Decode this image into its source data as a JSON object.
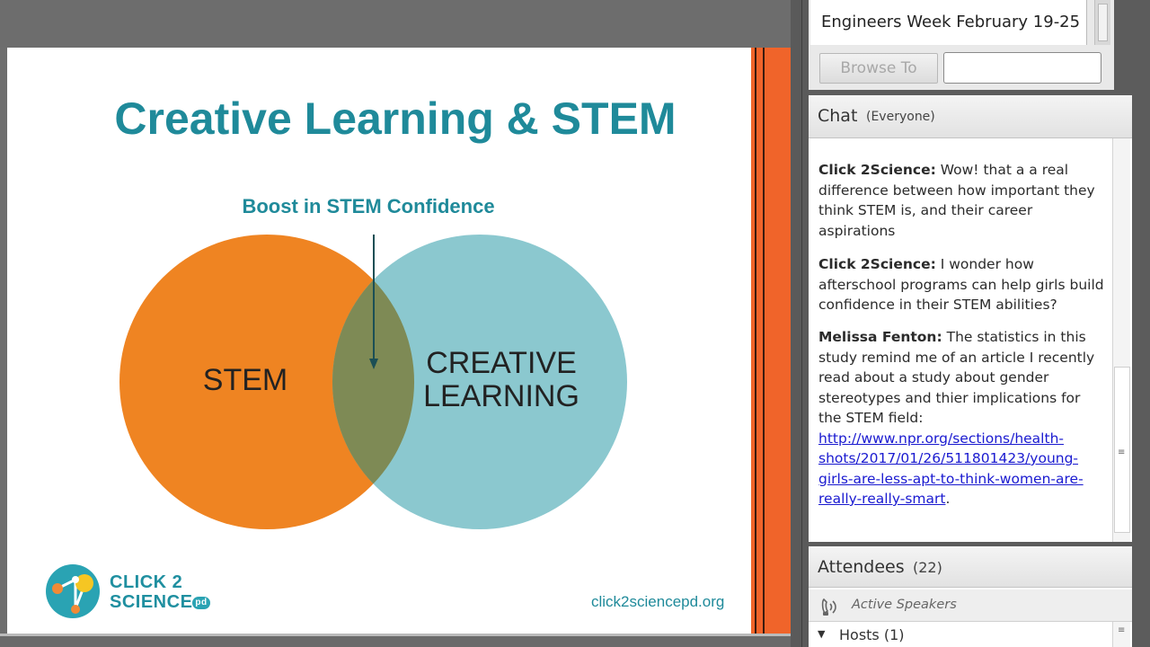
{
  "slide": {
    "title": "Creative Learning & STEM",
    "subtitle": "Boost in STEM Confidence",
    "venn_left_label": "STEM",
    "venn_right_label_line1": "CREATIVE",
    "venn_right_label_line2": "LEARNING",
    "logo_line1": "CLICK 2",
    "logo_line2": "SCIENCE",
    "logo_badge": "pd",
    "url": "click2sciencepd.org",
    "colors": {
      "title": "#1f8a9a",
      "stem_circle": "#ef8422",
      "creative_circle": "#8bc8cf",
      "overlap": "#7e8a55",
      "strip": "#f0642a"
    }
  },
  "web_pod": {
    "url_text": "Engineers Week February 19-25",
    "browse_label": "Browse To",
    "input_value": ""
  },
  "chat": {
    "title": "Chat",
    "scope": "(Everyone)",
    "messages": [
      {
        "author": "Click 2Science:",
        "text": " Wow!  that a a real difference between how important they think STEM is, and their career aspirations"
      },
      {
        "author": "Click 2Science:",
        "text": " I wonder how afterschool programs can help girls build confidence in their STEM abilities?"
      },
      {
        "author": "Melissa Fenton:",
        "text": " The statistics in this study remind me of an article I recently read about a study about gender stereotypes and thier implications for the STEM field: ",
        "link": "http://www.npr.org/sections/health-shots/2017/01/26/511801423/young-girls-are-less-apt-to-think-women-are-really-really-smart",
        "tail": "."
      }
    ]
  },
  "attendees": {
    "title": "Attendees",
    "count": "(22)",
    "active_speakers": "Active Speakers",
    "hosts": "Hosts (1)"
  }
}
